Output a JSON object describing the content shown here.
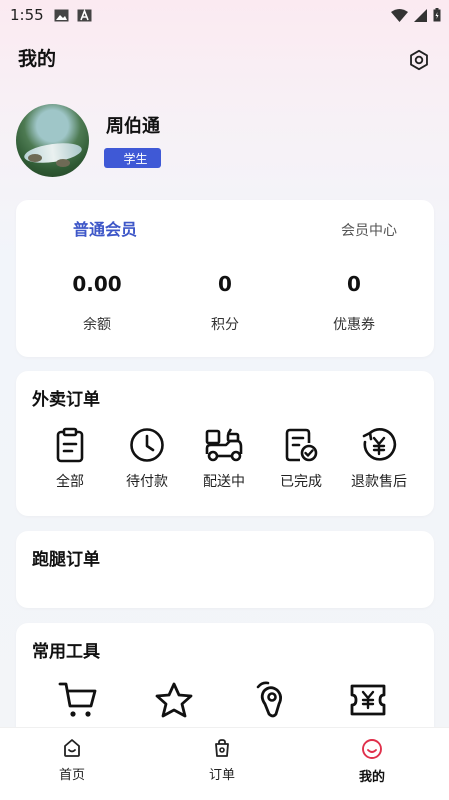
{
  "status_bar": {
    "time": "1:55"
  },
  "header": {
    "title": "我的"
  },
  "profile": {
    "name": "周伯通",
    "role": "学生"
  },
  "member": {
    "level": "普通会员",
    "center_link": "会员中心",
    "stats": [
      {
        "value": "0.00",
        "label": "余额"
      },
      {
        "value": "0",
        "label": "积分"
      },
      {
        "value": "0",
        "label": "优惠券"
      }
    ]
  },
  "takeout_orders": {
    "title": "外卖订单",
    "items": [
      {
        "label": "全部",
        "icon": "clipboard-icon"
      },
      {
        "label": "待付款",
        "icon": "clock-icon"
      },
      {
        "label": "配送中",
        "icon": "delivery-scooter-icon"
      },
      {
        "label": "已完成",
        "icon": "completed-document-icon"
      },
      {
        "label": "退款售后",
        "icon": "refund-yen-icon"
      }
    ]
  },
  "errand_orders": {
    "title": "跑腿订单"
  },
  "tools": {
    "title": "常用工具",
    "items": [
      {
        "icon": "shopping-cart-icon"
      },
      {
        "icon": "star-icon"
      },
      {
        "icon": "location-pin-icon"
      },
      {
        "icon": "yen-ticket-icon"
      }
    ]
  },
  "tabbar": {
    "tabs": [
      {
        "label": "首页",
        "icon": "home-icon"
      },
      {
        "label": "订单",
        "icon": "order-bag-icon"
      },
      {
        "label": "我的",
        "icon": "smile-icon",
        "active": true
      }
    ]
  },
  "colors": {
    "accent": "#3e57c8",
    "badge": "#3f59d6",
    "active_tab": "#e0304b"
  }
}
